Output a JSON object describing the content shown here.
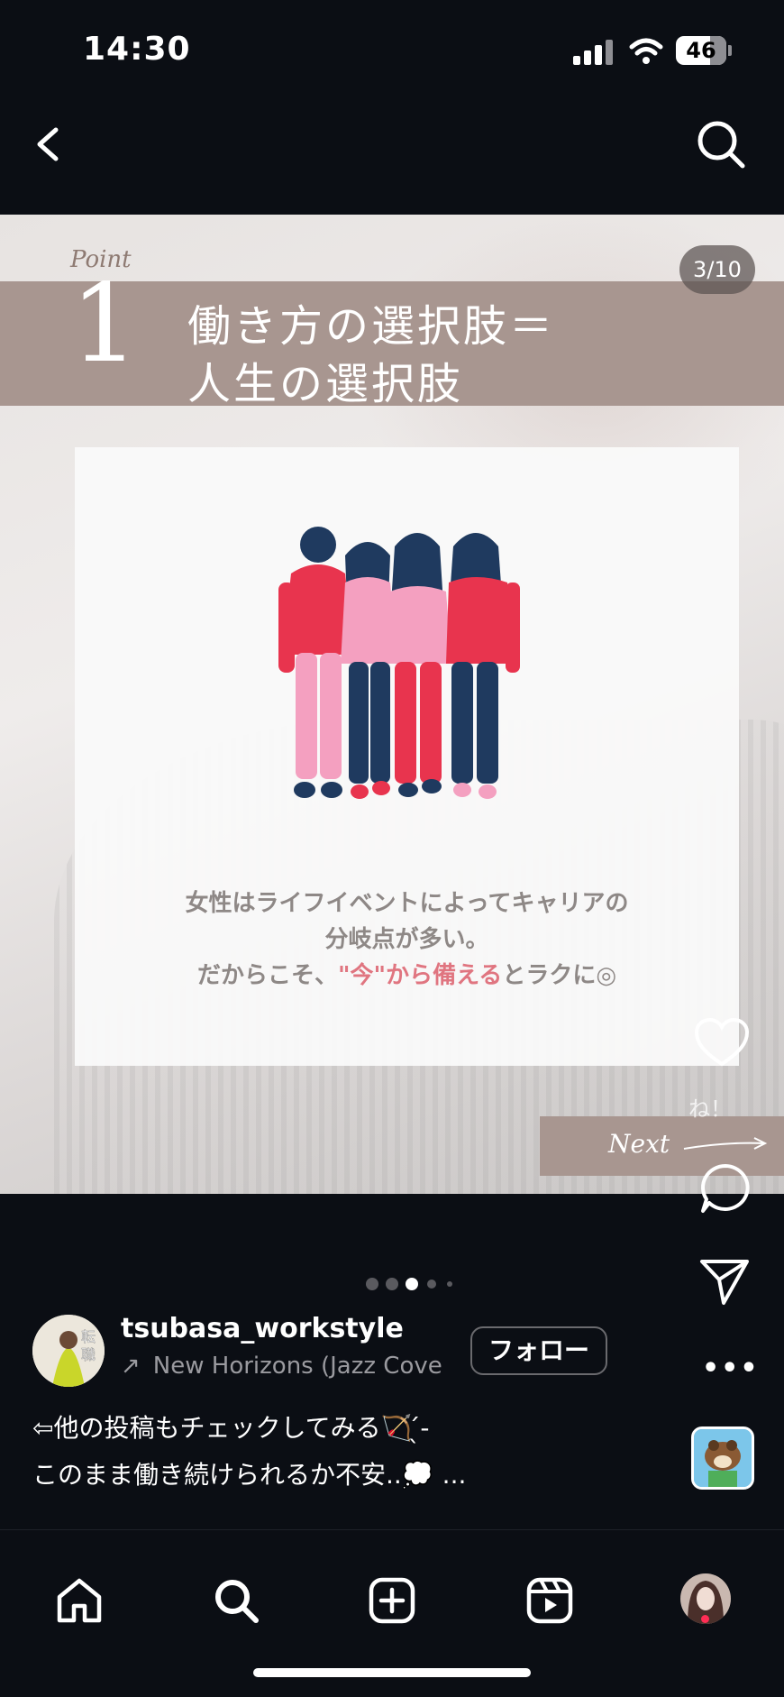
{
  "status_bar": {
    "time": "14:30",
    "battery": "46"
  },
  "post": {
    "point_label": "Point",
    "point_number": "1",
    "headline_line1": "働き方の選択肢＝",
    "headline_line2": "人生の選択肢",
    "counter": "3/10",
    "message_line1": "女性はライフイベントによってキャリアの",
    "message_line2": "分岐点が多い。",
    "message_line3_a": "だからこそ、",
    "message_line3_em": "\"今\"から備える",
    "message_line3_b": "とラクに◎",
    "next_label": "Next",
    "like_text": "ね！",
    "colors": {
      "band": "#a89690",
      "accent": "#e07580"
    }
  },
  "carousel": {
    "total_dots": 5,
    "active_index": 2
  },
  "profile": {
    "avatar_text_1": "転",
    "avatar_text_2": "職",
    "username": "tsubasa_workstyle",
    "music": "New Horizons (Jazz Cove",
    "follow_label": "フォロー"
  },
  "caption": {
    "line1": "⇦他の投稿もチェックしてみる🏹 ̖́-",
    "line2": "このまま働き続けられるか不安..💭",
    "more": "..."
  },
  "actions": {
    "more": "•••"
  },
  "tabbar": [
    "home-icon",
    "search-icon",
    "create-icon",
    "reels-icon",
    "profile-avatar"
  ]
}
